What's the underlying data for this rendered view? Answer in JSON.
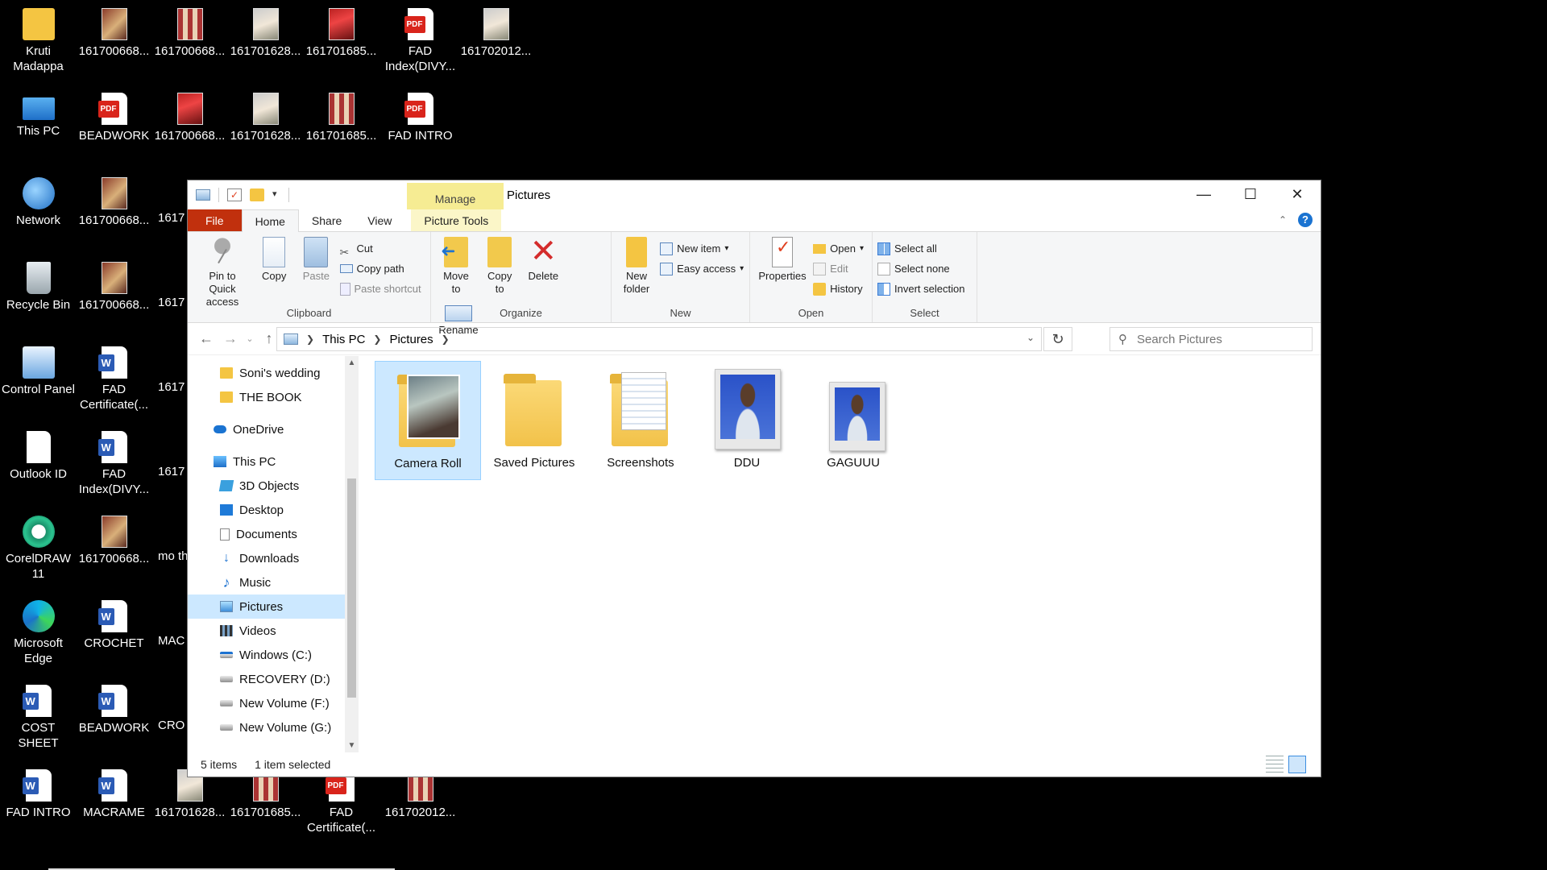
{
  "desktop": {
    "icons": [
      {
        "label": "Kruti Madappa",
        "icon": "folder-icon"
      },
      {
        "label": "161700668...",
        "icon": "image-file-icon"
      },
      {
        "label": "161700668...",
        "icon": "image-file-icon"
      },
      {
        "label": "161701628...",
        "icon": "image-file-icon"
      },
      {
        "label": "161701685...",
        "icon": "image-file-icon"
      },
      {
        "label": "FAD Index(DIVY...",
        "icon": "pdf-file-icon"
      },
      {
        "label": "161702012...",
        "icon": "image-file-icon"
      },
      {
        "label": "This PC",
        "icon": "this-pc-icon"
      },
      {
        "label": "BEADWORK",
        "icon": "pdf-file-icon"
      },
      {
        "label": "161700668...",
        "icon": "image-file-icon"
      },
      {
        "label": "161701628...",
        "icon": "image-file-icon"
      },
      {
        "label": "161701685...",
        "icon": "image-file-icon"
      },
      {
        "label": "FAD INTRO",
        "icon": "pdf-file-icon"
      },
      {
        "label": "Network",
        "icon": "network-icon"
      },
      {
        "label": "161700668...",
        "icon": "image-file-icon"
      },
      {
        "label": "Recycle Bin",
        "icon": "recycle-bin-icon"
      },
      {
        "label": "161700668...",
        "icon": "image-file-icon"
      },
      {
        "label": "Control Panel",
        "icon": "control-panel-icon"
      },
      {
        "label": "FAD Certificate(...",
        "icon": "word-file-icon"
      },
      {
        "label": "Outlook ID",
        "icon": "text-file-icon"
      },
      {
        "label": "FAD Index(DIVY...",
        "icon": "word-file-icon"
      },
      {
        "label": "CorelDRAW 11",
        "icon": "coreldraw-icon"
      },
      {
        "label": "161700668...",
        "icon": "image-file-icon"
      },
      {
        "label": "Microsoft Edge",
        "icon": "edge-icon"
      },
      {
        "label": "CROCHET",
        "icon": "word-file-icon"
      },
      {
        "label": "COST SHEET",
        "icon": "word-file-icon"
      },
      {
        "label": "BEADWORK",
        "icon": "word-file-icon"
      },
      {
        "label": "FAD INTRO",
        "icon": "word-file-icon"
      },
      {
        "label": "MACRAME",
        "icon": "word-file-icon"
      },
      {
        "label": "161701628...",
        "icon": "image-file-icon"
      },
      {
        "label": "161701685...",
        "icon": "image-file-icon"
      },
      {
        "label": "FAD Certificate(...",
        "icon": "pdf-file-icon"
      },
      {
        "label": "161702012...",
        "icon": "image-file-icon"
      }
    ],
    "partial_labels": [
      "1617",
      "1617",
      "1617",
      "1617",
      "1617",
      "mo thewa",
      "MAC",
      "CRO"
    ]
  },
  "window": {
    "title": "Pictures",
    "manage_tab": "Manage",
    "tabs": {
      "file": "File",
      "home": "Home",
      "share": "Share",
      "view": "View",
      "picture_tools": "Picture Tools"
    },
    "help": "?",
    "ribbon": {
      "clipboard": {
        "label": "Clipboard",
        "pin": "Pin to Quick access",
        "copy": "Copy",
        "paste": "Paste",
        "cut": "Cut",
        "copy_path": "Copy path",
        "paste_shortcut": "Paste shortcut"
      },
      "organize": {
        "label": "Organize",
        "move_to": "Move to",
        "copy_to": "Copy to",
        "delete": "Delete",
        "rename": "Rename"
      },
      "new": {
        "label": "New",
        "new_folder": "New folder",
        "new_item": "New item",
        "easy_access": "Easy access"
      },
      "open": {
        "label": "Open",
        "properties": "Properties",
        "open": "Open",
        "edit": "Edit",
        "history": "History"
      },
      "select": {
        "label": "Select",
        "select_all": "Select all",
        "select_none": "Select none",
        "invert_selection": "Invert selection"
      }
    },
    "address": {
      "crumbs": [
        "This PC",
        "Pictures"
      ],
      "search_placeholder": "Search Pictures"
    },
    "nav_pane": [
      {
        "label": "Soni's wedding",
        "icon": "folder-icon",
        "indent": 1
      },
      {
        "label": "THE BOOK",
        "icon": "folder-icon",
        "indent": 1
      },
      {
        "label": "OneDrive",
        "icon": "onedrive-icon",
        "indent": 0
      },
      {
        "label": "This PC",
        "icon": "this-pc-icon",
        "indent": 0
      },
      {
        "label": "3D Objects",
        "icon": "3d-objects-icon",
        "indent": 1
      },
      {
        "label": "Desktop",
        "icon": "desktop-folder-icon",
        "indent": 1
      },
      {
        "label": "Documents",
        "icon": "documents-icon",
        "indent": 1
      },
      {
        "label": "Downloads",
        "icon": "downloads-icon",
        "indent": 1
      },
      {
        "label": "Music",
        "icon": "music-icon",
        "indent": 1
      },
      {
        "label": "Pictures",
        "icon": "pictures-icon",
        "indent": 1,
        "selected": true
      },
      {
        "label": "Videos",
        "icon": "videos-icon",
        "indent": 1
      },
      {
        "label": "Windows (C:)",
        "icon": "drive-icon",
        "indent": 1
      },
      {
        "label": "RECOVERY (D:)",
        "icon": "drive-icon",
        "indent": 1
      },
      {
        "label": "New Volume (F:)",
        "icon": "drive-icon",
        "indent": 1
      },
      {
        "label": "New Volume (G:)",
        "icon": "drive-icon",
        "indent": 1
      }
    ],
    "files": [
      {
        "label": "Camera Roll",
        "type": "folder-with-photo",
        "selected": true
      },
      {
        "label": "Saved Pictures",
        "type": "folder"
      },
      {
        "label": "Screenshots",
        "type": "folder-with-docs"
      },
      {
        "label": "DDU",
        "type": "photo"
      },
      {
        "label": "GAGUUU",
        "type": "photo"
      }
    ],
    "status": {
      "count": "5 items",
      "selection": "1 item selected"
    }
  }
}
